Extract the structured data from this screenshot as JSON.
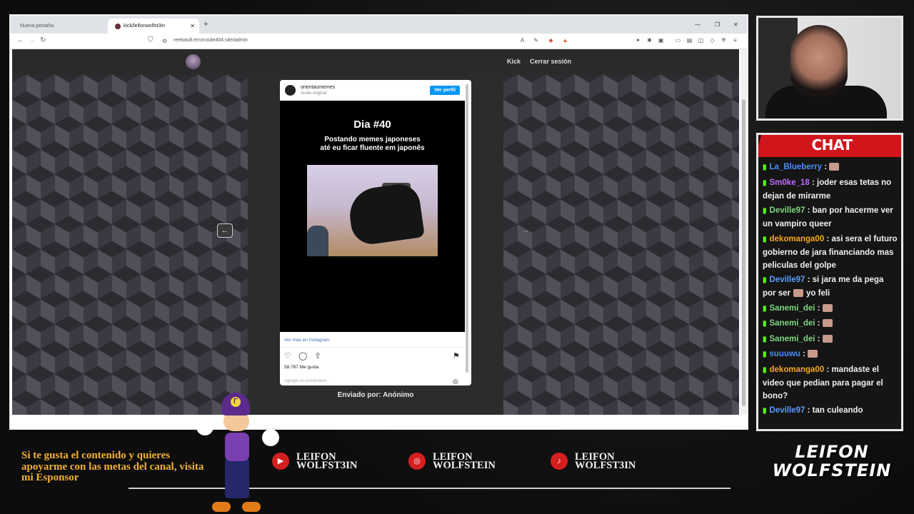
{
  "browser": {
    "tabs": [
      {
        "label": "Nueva pestaña"
      },
      {
        "label": "kick/leifonwolfst3in"
      }
    ],
    "url": "reelvault.errorcode404.site/admin"
  },
  "site": {
    "nav": {
      "kick": "Kick",
      "logout": "Cerrar sesión"
    },
    "prev_arrow": "←",
    "next_arrow": "→",
    "sent_by": "Enviado por: Anónimo"
  },
  "instagram": {
    "username": "orientaumemes",
    "audio": "Audio original",
    "follow_label": "Ver perfil",
    "day_title": "Dia #40",
    "caption_line1": "Postando memes japoneses",
    "caption_line2": "até eu ficar fluente em japonês",
    "view_more": "Ver más en Instagram",
    "likes": "58.787 Me gusta",
    "comment_placeholder": "Agrega un comentario..."
  },
  "chat": {
    "title": "CHAT",
    "messages": [
      {
        "user": "La_Blueberry",
        "text": "",
        "color": "#4a8cff"
      },
      {
        "user": "Sm0ke_18",
        "text": "joder esas tetas no dejan de mirarme",
        "color": "#c06cff"
      },
      {
        "user": "Deville97",
        "text": "ban por hacerme ver un vampiro queer",
        "color": "#7fd67f"
      },
      {
        "user": "dekomanga00",
        "text": "asi sera el futuro gobierno de jara financiando mas peliculas del golpe",
        "color": "#f5a623"
      },
      {
        "user": "Deville97",
        "text": "si jara me da pega por ser",
        "text2": "yo feli",
        "color": "#5a9dff"
      },
      {
        "user": "Sanemi_dei",
        "text": "",
        "color": "#7fd67f"
      },
      {
        "user": "Sanemi_dei",
        "text": "",
        "color": "#7fd67f"
      },
      {
        "user": "Sanemi_dei",
        "text": "",
        "color": "#7fd67f"
      },
      {
        "user": "suuuwu",
        "text": "",
        "color": "#4a8cff"
      },
      {
        "user": "dekomanga00",
        "text": "mandaste el video que pedian para pagar el bono?",
        "color": "#f5a623"
      },
      {
        "user": "Deville97",
        "text": "tan culeando",
        "color": "#5a9dff"
      }
    ]
  },
  "footer": {
    "sponsor_text": "Si te gusta el contenido y quieres apoyarme con las metas del canal, visita mi Esponsor",
    "socials": [
      {
        "line1": "LEIFON",
        "line2": "WOLFST3IN"
      },
      {
        "line1": "LEIFON",
        "line2": "WOLFSTEIN"
      },
      {
        "line1": "LEIFON",
        "line2": "WOLFST3IN"
      }
    ],
    "logo_line1": "LEIFON",
    "logo_line2": "WOLFSTEIN"
  }
}
